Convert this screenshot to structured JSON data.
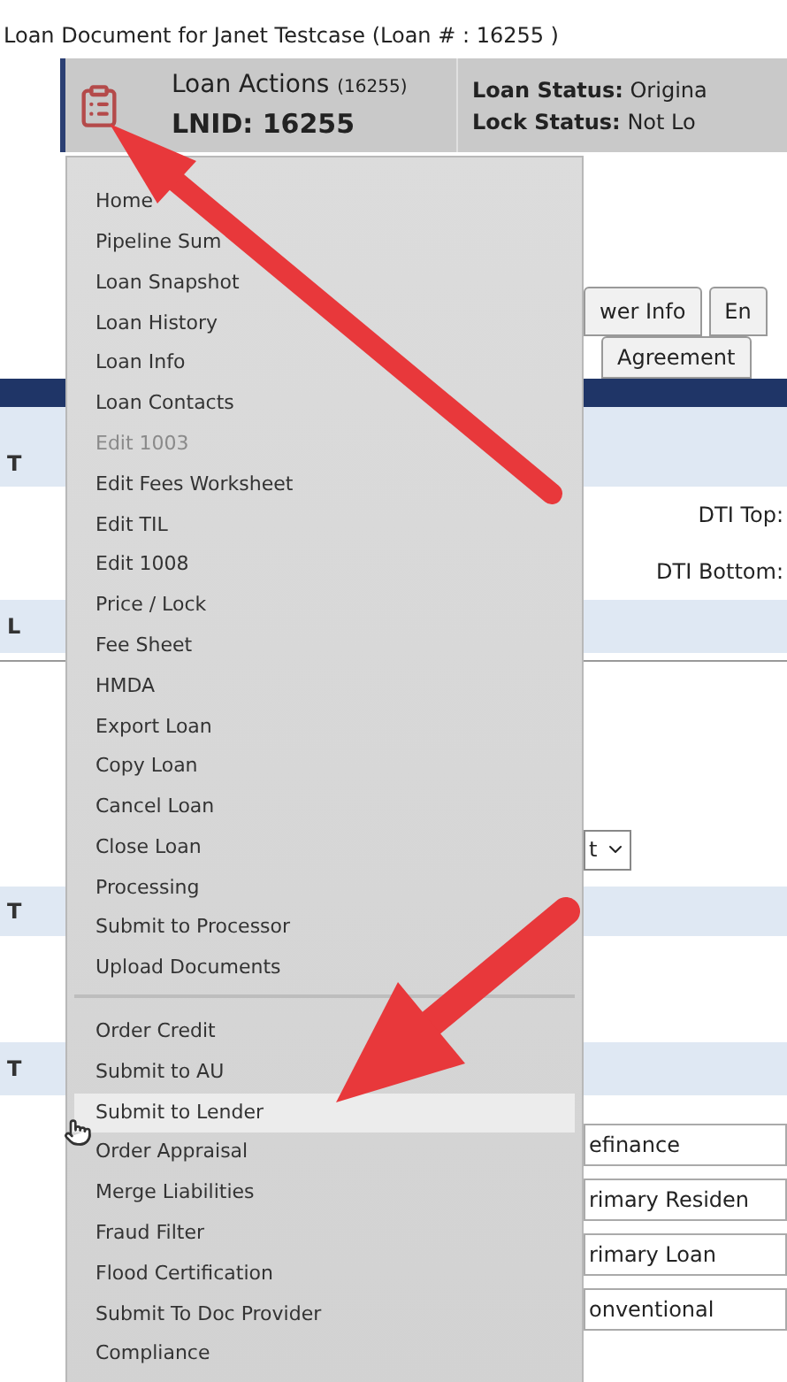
{
  "page_title": "Loan Document for Janet Testcase (Loan # : 16255 )",
  "header": {
    "actions_label": "Loan Actions",
    "actions_count": "(16255)",
    "lnid": "LNID: 16255",
    "loan_status_label": "Loan Status:",
    "loan_status_value": "Origina",
    "lock_status_label": "Lock Status:",
    "lock_status_value": "Not Lo"
  },
  "tabs_row_1": [
    {
      "label": "wer Info",
      "selected": false
    },
    {
      "label": "En",
      "selected": false
    }
  ],
  "tabs_row_2": [
    {
      "label": "Agreement",
      "selected": false
    }
  ],
  "section_letters": [
    "T",
    "L",
    "T",
    "T"
  ],
  "dti_top_label": "DTI Top:",
  "dti_bottom_label": "DTI Bottom:",
  "select_value": "t",
  "field_values": [
    "efinance",
    "rimary Residen",
    "rimary Loan",
    "onventional"
  ],
  "menu": {
    "sections": [
      [
        {
          "label": "Home",
          "disabled": false,
          "hovered": false
        },
        {
          "label": "Pipeline Sum",
          "disabled": false,
          "hovered": false
        },
        {
          "label": "Loan Snapshot",
          "disabled": false,
          "hovered": false
        },
        {
          "label": "Loan History",
          "disabled": false,
          "hovered": false
        },
        {
          "label": "Loan Info",
          "disabled": false,
          "hovered": false
        },
        {
          "label": "Loan Contacts",
          "disabled": false,
          "hovered": false
        },
        {
          "label": "Edit 1003",
          "disabled": true,
          "hovered": false
        },
        {
          "label": "Edit Fees Worksheet",
          "disabled": false,
          "hovered": false
        },
        {
          "label": "Edit TIL",
          "disabled": false,
          "hovered": false
        },
        {
          "label": "Edit 1008",
          "disabled": false,
          "hovered": false
        },
        {
          "label": "Price / Lock",
          "disabled": false,
          "hovered": false
        },
        {
          "label": "Fee Sheet",
          "disabled": false,
          "hovered": false
        },
        {
          "label": "HMDA",
          "disabled": false,
          "hovered": false
        },
        {
          "label": "Export Loan",
          "disabled": false,
          "hovered": false
        },
        {
          "label": "Copy Loan",
          "disabled": false,
          "hovered": false
        },
        {
          "label": "Cancel Loan",
          "disabled": false,
          "hovered": false
        },
        {
          "label": "Close Loan",
          "disabled": false,
          "hovered": false
        },
        {
          "label": "Processing",
          "disabled": false,
          "hovered": false
        },
        {
          "label": "Submit to Processor",
          "disabled": false,
          "hovered": false
        },
        {
          "label": "Upload Documents",
          "disabled": false,
          "hovered": false
        }
      ],
      [
        {
          "label": "Order Credit",
          "disabled": false,
          "hovered": false
        },
        {
          "label": "Submit to AU",
          "disabled": false,
          "hovered": false
        },
        {
          "label": "Submit to Lender",
          "disabled": false,
          "hovered": true
        },
        {
          "label": "Order Appraisal",
          "disabled": false,
          "hovered": false
        },
        {
          "label": "Merge Liabilities",
          "disabled": false,
          "hovered": false
        },
        {
          "label": "Fraud Filter",
          "disabled": false,
          "hovered": false
        },
        {
          "label": "Flood Certification",
          "disabled": false,
          "hovered": false
        },
        {
          "label": "Submit To Doc Provider",
          "disabled": false,
          "hovered": false
        },
        {
          "label": "Compliance",
          "disabled": false,
          "hovered": false
        }
      ]
    ]
  }
}
